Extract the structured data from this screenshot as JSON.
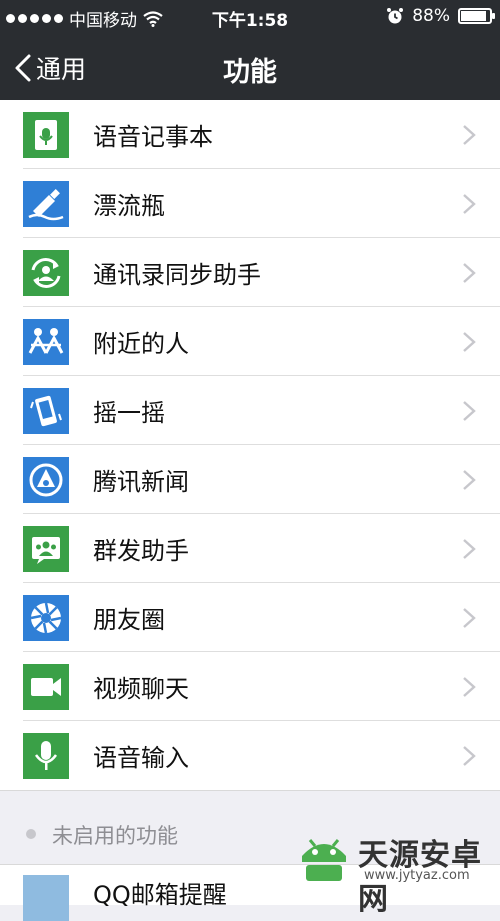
{
  "status_bar": {
    "carrier": "中国移动",
    "time": "下午1:58",
    "battery": "88%",
    "battery_level": 0.88
  },
  "nav": {
    "back_label": "通用",
    "title": "功能"
  },
  "items": [
    {
      "label": "语音记事本",
      "icon": "voice-notepad-icon",
      "color": "#3aa047"
    },
    {
      "label": "漂流瓶",
      "icon": "drift-bottle-icon",
      "color": "#2f7fd6"
    },
    {
      "label": "通讯录同步助手",
      "icon": "contacts-sync-icon",
      "color": "#3aa047"
    },
    {
      "label": "附近的人",
      "icon": "people-nearby-icon",
      "color": "#2f7fd6"
    },
    {
      "label": "摇一摇",
      "icon": "shake-icon",
      "color": "#2f7fd6"
    },
    {
      "label": "腾讯新闻",
      "icon": "tencent-news-icon",
      "color": "#2f7fd6"
    },
    {
      "label": "群发助手",
      "icon": "broadcast-assistant-icon",
      "color": "#3aa047"
    },
    {
      "label": "朋友圈",
      "icon": "moments-icon",
      "color": "#2f7fd6"
    },
    {
      "label": "视频聊天",
      "icon": "video-chat-icon",
      "color": "#3aa047"
    },
    {
      "label": "语音输入",
      "icon": "voice-input-icon",
      "color": "#3aa047"
    }
  ],
  "disabled_section": {
    "title": "未启用的功能"
  },
  "disabled_items": [
    {
      "label": "QQ邮箱提醒"
    }
  ],
  "watermark": {
    "title": "天源安卓网",
    "url": "www.jytyaz.com"
  }
}
